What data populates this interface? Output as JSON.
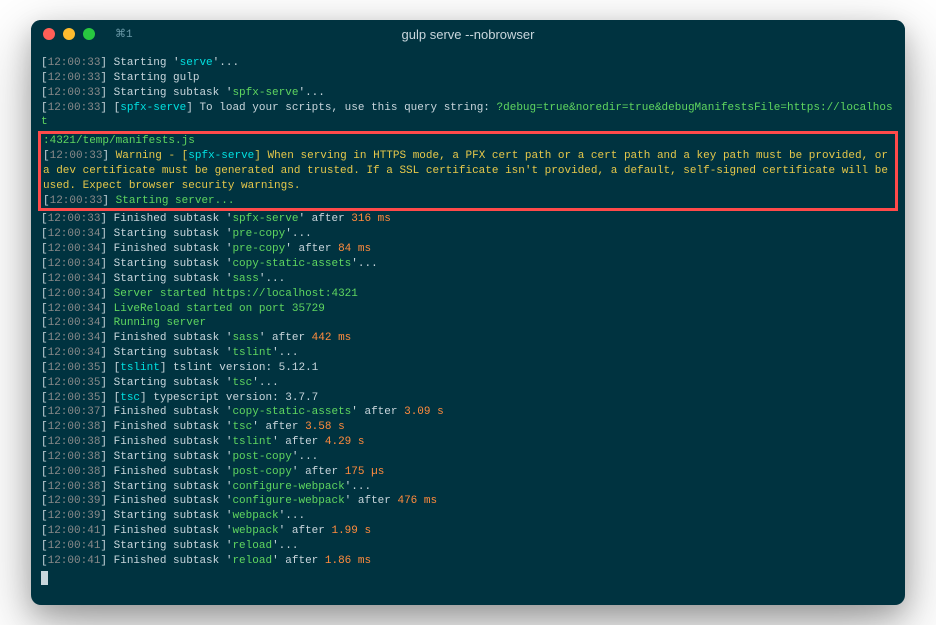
{
  "window": {
    "title": "gulp serve --nobrowser",
    "tab_indicator": "⌘1"
  },
  "highlight": {
    "ts1": "12:00:33",
    "warn_prefix": "Warning - [",
    "warn_module": "spfx-serve",
    "warn_suffix": "] When serving in HTTPS mode, a PFX cert path or a cert path and a key path must be provided, or a dev certificate must be generated and trusted. If a SSL certificate isn't provided, a default, self-signed certificate will be used. Expect browser security warnings.",
    "ts2": "12:00:33",
    "starting_server": "Starting server..."
  },
  "lines": [
    {
      "ts": "12:00:33",
      "segments": [
        {
          "t": " Starting '",
          "c": "text-default"
        },
        {
          "t": "serve",
          "c": "text-cyan"
        },
        {
          "t": "'...",
          "c": "text-default"
        }
      ]
    },
    {
      "ts": "12:00:33",
      "segments": [
        {
          "t": " Starting gulp",
          "c": "text-default"
        }
      ]
    },
    {
      "ts": "12:00:33",
      "segments": [
        {
          "t": " Starting subtask '",
          "c": "text-default"
        },
        {
          "t": "spfx-serve",
          "c": "text-green"
        },
        {
          "t": "'...",
          "c": "text-default"
        }
      ]
    },
    {
      "ts": "12:00:33",
      "segments": [
        {
          "t": " [",
          "c": "text-default"
        },
        {
          "t": "spfx-serve",
          "c": "text-cyan"
        },
        {
          "t": "] To load your scripts, use this query string: ",
          "c": "text-default"
        },
        {
          "t": "?debug=true&noredir=true&debugManifestsFile=https://localhost",
          "c": "text-green"
        }
      ]
    }
  ],
  "preline": ":4321/temp/manifests.js",
  "lines2": [
    {
      "ts": "12:00:33",
      "segments": [
        {
          "t": " Finished subtask '",
          "c": "text-default"
        },
        {
          "t": "spfx-serve",
          "c": "text-green"
        },
        {
          "t": "' after ",
          "c": "text-default"
        },
        {
          "t": "316 ms",
          "c": "text-orange"
        }
      ]
    },
    {
      "ts": "12:00:34",
      "segments": [
        {
          "t": " Starting subtask '",
          "c": "text-default"
        },
        {
          "t": "pre-copy",
          "c": "text-green"
        },
        {
          "t": "'...",
          "c": "text-default"
        }
      ]
    },
    {
      "ts": "12:00:34",
      "segments": [
        {
          "t": " Finished subtask '",
          "c": "text-default"
        },
        {
          "t": "pre-copy",
          "c": "text-green"
        },
        {
          "t": "' after ",
          "c": "text-default"
        },
        {
          "t": "84 ms",
          "c": "text-orange"
        }
      ]
    },
    {
      "ts": "12:00:34",
      "segments": [
        {
          "t": " Starting subtask '",
          "c": "text-default"
        },
        {
          "t": "copy-static-assets",
          "c": "text-green"
        },
        {
          "t": "'...",
          "c": "text-default"
        }
      ]
    },
    {
      "ts": "12:00:34",
      "segments": [
        {
          "t": " Starting subtask '",
          "c": "text-default"
        },
        {
          "t": "sass",
          "c": "text-green"
        },
        {
          "t": "'...",
          "c": "text-default"
        }
      ]
    },
    {
      "ts": "12:00:34",
      "segments": [
        {
          "t": " Server started https://localhost:4321",
          "c": "text-green"
        }
      ]
    },
    {
      "ts": "12:00:34",
      "segments": [
        {
          "t": " LiveReload started on port 35729",
          "c": "text-green"
        }
      ]
    },
    {
      "ts": "12:00:34",
      "segments": [
        {
          "t": " Running server",
          "c": "text-green"
        }
      ]
    },
    {
      "ts": "12:00:34",
      "segments": [
        {
          "t": " Finished subtask '",
          "c": "text-default"
        },
        {
          "t": "sass",
          "c": "text-green"
        },
        {
          "t": "' after ",
          "c": "text-default"
        },
        {
          "t": "442 ms",
          "c": "text-orange"
        }
      ]
    },
    {
      "ts": "12:00:34",
      "segments": [
        {
          "t": " Starting subtask '",
          "c": "text-default"
        },
        {
          "t": "tslint",
          "c": "text-green"
        },
        {
          "t": "'...",
          "c": "text-default"
        }
      ]
    },
    {
      "ts": "12:00:35",
      "segments": [
        {
          "t": " [",
          "c": "text-default"
        },
        {
          "t": "tslint",
          "c": "text-cyan"
        },
        {
          "t": "] tslint version: 5.12.1",
          "c": "text-default"
        }
      ]
    },
    {
      "ts": "12:00:35",
      "segments": [
        {
          "t": " Starting subtask '",
          "c": "text-default"
        },
        {
          "t": "tsc",
          "c": "text-green"
        },
        {
          "t": "'...",
          "c": "text-default"
        }
      ]
    },
    {
      "ts": "12:00:35",
      "segments": [
        {
          "t": " [",
          "c": "text-default"
        },
        {
          "t": "tsc",
          "c": "text-cyan"
        },
        {
          "t": "] typescript version: 3.7.7",
          "c": "text-default"
        }
      ]
    },
    {
      "ts": "12:00:37",
      "segments": [
        {
          "t": " Finished subtask '",
          "c": "text-default"
        },
        {
          "t": "copy-static-assets",
          "c": "text-green"
        },
        {
          "t": "' after ",
          "c": "text-default"
        },
        {
          "t": "3.09 s",
          "c": "text-orange"
        }
      ]
    },
    {
      "ts": "12:00:38",
      "segments": [
        {
          "t": " Finished subtask '",
          "c": "text-default"
        },
        {
          "t": "tsc",
          "c": "text-green"
        },
        {
          "t": "' after ",
          "c": "text-default"
        },
        {
          "t": "3.58 s",
          "c": "text-orange"
        }
      ]
    },
    {
      "ts": "12:00:38",
      "segments": [
        {
          "t": " Finished subtask '",
          "c": "text-default"
        },
        {
          "t": "tslint",
          "c": "text-green"
        },
        {
          "t": "' after ",
          "c": "text-default"
        },
        {
          "t": "4.29 s",
          "c": "text-orange"
        }
      ]
    },
    {
      "ts": "12:00:38",
      "segments": [
        {
          "t": " Starting subtask '",
          "c": "text-default"
        },
        {
          "t": "post-copy",
          "c": "text-green"
        },
        {
          "t": "'...",
          "c": "text-default"
        }
      ]
    },
    {
      "ts": "12:00:38",
      "segments": [
        {
          "t": " Finished subtask '",
          "c": "text-default"
        },
        {
          "t": "post-copy",
          "c": "text-green"
        },
        {
          "t": "' after ",
          "c": "text-default"
        },
        {
          "t": "175 µs",
          "c": "text-orange"
        }
      ]
    },
    {
      "ts": "12:00:38",
      "segments": [
        {
          "t": " Starting subtask '",
          "c": "text-default"
        },
        {
          "t": "configure-webpack",
          "c": "text-green"
        },
        {
          "t": "'...",
          "c": "text-default"
        }
      ]
    },
    {
      "ts": "12:00:39",
      "segments": [
        {
          "t": " Finished subtask '",
          "c": "text-default"
        },
        {
          "t": "configure-webpack",
          "c": "text-green"
        },
        {
          "t": "' after ",
          "c": "text-default"
        },
        {
          "t": "476 ms",
          "c": "text-orange"
        }
      ]
    },
    {
      "ts": "12:00:39",
      "segments": [
        {
          "t": " Starting subtask '",
          "c": "text-default"
        },
        {
          "t": "webpack",
          "c": "text-green"
        },
        {
          "t": "'...",
          "c": "text-default"
        }
      ]
    },
    {
      "ts": "12:00:41",
      "segments": [
        {
          "t": " Finished subtask '",
          "c": "text-default"
        },
        {
          "t": "webpack",
          "c": "text-green"
        },
        {
          "t": "' after ",
          "c": "text-default"
        },
        {
          "t": "1.99 s",
          "c": "text-orange"
        }
      ]
    },
    {
      "ts": "12:00:41",
      "segments": [
        {
          "t": " Starting subtask '",
          "c": "text-default"
        },
        {
          "t": "reload",
          "c": "text-green"
        },
        {
          "t": "'...",
          "c": "text-default"
        }
      ]
    },
    {
      "ts": "12:00:41",
      "segments": [
        {
          "t": " Finished subtask '",
          "c": "text-default"
        },
        {
          "t": "reload",
          "c": "text-green"
        },
        {
          "t": "' after ",
          "c": "text-default"
        },
        {
          "t": "1.86 ms",
          "c": "text-orange"
        }
      ]
    }
  ]
}
